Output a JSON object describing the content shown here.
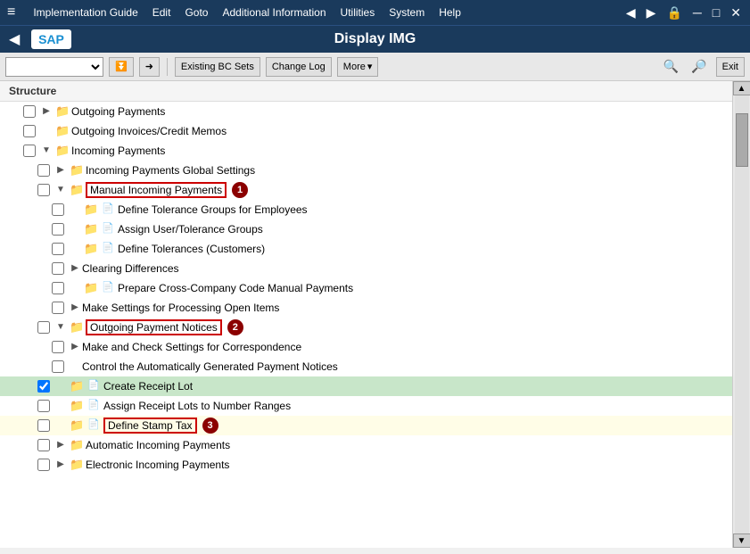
{
  "window": {
    "title": "Display IMG",
    "back_label": "◀"
  },
  "sap_logo": "SAP",
  "menubar": {
    "items": [
      {
        "id": "hamburger",
        "label": "≡"
      },
      {
        "id": "implementation-guide",
        "label": "Implementation Guide"
      },
      {
        "id": "edit",
        "label": "Edit"
      },
      {
        "id": "goto",
        "label": "Goto"
      },
      {
        "id": "additional-information",
        "label": "Additional Information"
      },
      {
        "id": "utilities",
        "label": "Utilities"
      },
      {
        "id": "system",
        "label": "System"
      },
      {
        "id": "help",
        "label": "Help"
      }
    ],
    "window_controls": [
      "◀",
      "▶",
      "🔒",
      "─",
      "□",
      "✕"
    ]
  },
  "toolbar": {
    "dropdown_placeholder": "",
    "buttons": [
      {
        "id": "down-arrows",
        "label": "⏬"
      },
      {
        "id": "arrow-right",
        "label": "➡"
      },
      {
        "id": "existing-bc-sets",
        "label": "Existing BC Sets"
      },
      {
        "id": "change-log",
        "label": "Change Log"
      },
      {
        "id": "more",
        "label": "More ▾"
      }
    ],
    "right_buttons": [
      {
        "id": "search",
        "label": "🔍"
      },
      {
        "id": "search-plus",
        "label": "🔎"
      },
      {
        "id": "exit",
        "label": "Exit"
      }
    ]
  },
  "structure_header": "Structure",
  "tree": {
    "items": [
      {
        "id": "outgoing-payments",
        "indent": 1,
        "expand": "▶",
        "has_folder": true,
        "has_doc": false,
        "label": "Outgoing Payments",
        "checkbox": true,
        "highlight": false,
        "badge": null,
        "row_class": ""
      },
      {
        "id": "outgoing-invoices",
        "indent": 1,
        "expand": "",
        "has_folder": true,
        "has_doc": false,
        "label": "Outgoing Invoices/Credit Memos",
        "checkbox": true,
        "highlight": false,
        "badge": null,
        "row_class": ""
      },
      {
        "id": "incoming-payments",
        "indent": 1,
        "expand": "▼",
        "has_folder": true,
        "has_doc": false,
        "label": "Incoming Payments",
        "checkbox": true,
        "highlight": false,
        "badge": null,
        "row_class": ""
      },
      {
        "id": "incoming-payments-global",
        "indent": 2,
        "expand": "▶",
        "has_folder": true,
        "has_doc": false,
        "label": "Incoming Payments Global Settings",
        "checkbox": true,
        "highlight": false,
        "badge": null,
        "row_class": ""
      },
      {
        "id": "manual-incoming-payments",
        "indent": 2,
        "expand": "▼",
        "has_folder": true,
        "has_doc": false,
        "label": "Manual Incoming Payments",
        "checkbox": true,
        "highlight": true,
        "badge": 1,
        "row_class": "boxed"
      },
      {
        "id": "define-tolerance-groups",
        "indent": 3,
        "expand": "",
        "has_folder": true,
        "has_doc": true,
        "label": "Define Tolerance Groups for Employees",
        "checkbox": true,
        "highlight": false,
        "badge": null,
        "row_class": ""
      },
      {
        "id": "assign-user-tolerance",
        "indent": 3,
        "expand": "",
        "has_folder": true,
        "has_doc": true,
        "label": "Assign User/Tolerance Groups",
        "checkbox": true,
        "highlight": false,
        "badge": null,
        "row_class": ""
      },
      {
        "id": "define-tolerances-customers",
        "indent": 3,
        "expand": "",
        "has_folder": true,
        "has_doc": true,
        "label": "Define Tolerances (Customers)",
        "checkbox": true,
        "highlight": false,
        "badge": null,
        "row_class": ""
      },
      {
        "id": "clearing-differences",
        "indent": 3,
        "expand": "▶",
        "has_folder": false,
        "has_doc": false,
        "label": "Clearing Differences",
        "checkbox": true,
        "highlight": false,
        "badge": null,
        "row_class": ""
      },
      {
        "id": "prepare-cross-company",
        "indent": 3,
        "expand": "",
        "has_folder": true,
        "has_doc": true,
        "label": "Prepare Cross-Company Code Manual Payments",
        "checkbox": true,
        "highlight": false,
        "badge": null,
        "row_class": ""
      },
      {
        "id": "make-settings-processing",
        "indent": 3,
        "expand": "▶",
        "has_folder": false,
        "has_doc": false,
        "label": "Make Settings for Processing Open Items",
        "checkbox": true,
        "highlight": false,
        "badge": null,
        "row_class": ""
      },
      {
        "id": "outgoing-payment-notices",
        "indent": 2,
        "expand": "▼",
        "has_folder": true,
        "has_doc": false,
        "label": "Outgoing Payment Notices",
        "checkbox": true,
        "highlight": true,
        "badge": 2,
        "row_class": "boxed"
      },
      {
        "id": "make-check-correspondence",
        "indent": 3,
        "expand": "▶",
        "has_folder": false,
        "has_doc": false,
        "label": "Make and Check Settings for Correspondence",
        "checkbox": true,
        "highlight": false,
        "badge": null,
        "row_class": ""
      },
      {
        "id": "control-automatically",
        "indent": 3,
        "expand": "",
        "has_folder": false,
        "has_doc": false,
        "label": "Control the Automatically Generated Payment Notices",
        "checkbox": true,
        "highlight": false,
        "badge": null,
        "row_class": ""
      },
      {
        "id": "create-receipt-lot",
        "indent": 2,
        "expand": "",
        "has_folder": true,
        "has_doc": true,
        "label": "Create Receipt Lot",
        "checkbox": true,
        "highlight": false,
        "badge": null,
        "row_class": "selected"
      },
      {
        "id": "assign-receipt-lots",
        "indent": 2,
        "expand": "",
        "has_folder": true,
        "has_doc": true,
        "label": "Assign Receipt Lots to Number Ranges",
        "checkbox": true,
        "highlight": false,
        "badge": null,
        "row_class": ""
      },
      {
        "id": "define-stamp-tax",
        "indent": 2,
        "expand": "",
        "has_folder": true,
        "has_doc": true,
        "label": "Define Stamp Tax",
        "checkbox": true,
        "highlight": true,
        "badge": 3,
        "row_class": "boxed yellow-row"
      },
      {
        "id": "automatic-incoming-payments",
        "indent": 2,
        "expand": "▶",
        "has_folder": true,
        "has_doc": false,
        "label": "Automatic Incoming Payments",
        "checkbox": true,
        "highlight": false,
        "badge": null,
        "row_class": ""
      },
      {
        "id": "electronic-incoming-payments",
        "indent": 2,
        "expand": "▶",
        "has_folder": true,
        "has_doc": false,
        "label": "Electronic Incoming Payments",
        "checkbox": true,
        "highlight": false,
        "badge": null,
        "row_class": ""
      }
    ]
  }
}
